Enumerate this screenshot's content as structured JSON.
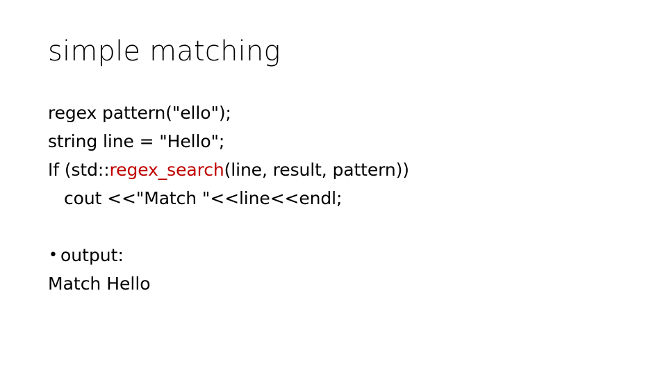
{
  "slide": {
    "title": "simple matching",
    "code": {
      "line1": "regex pattern(\"ello\");",
      "line2": "string line = \"Hello\";",
      "line3_prefix": "If (std::",
      "line3_highlight": "regex_search",
      "line3_suffix": "(line, result, pattern))",
      "line4": "cout <<\"Match \"<<line<<endl;"
    },
    "bullet": {
      "marker": "•",
      "label": "output:"
    },
    "output": "Match Hello",
    "colors": {
      "background": "#FFFFFF",
      "text": "#000000",
      "highlight": "#C00000"
    }
  }
}
